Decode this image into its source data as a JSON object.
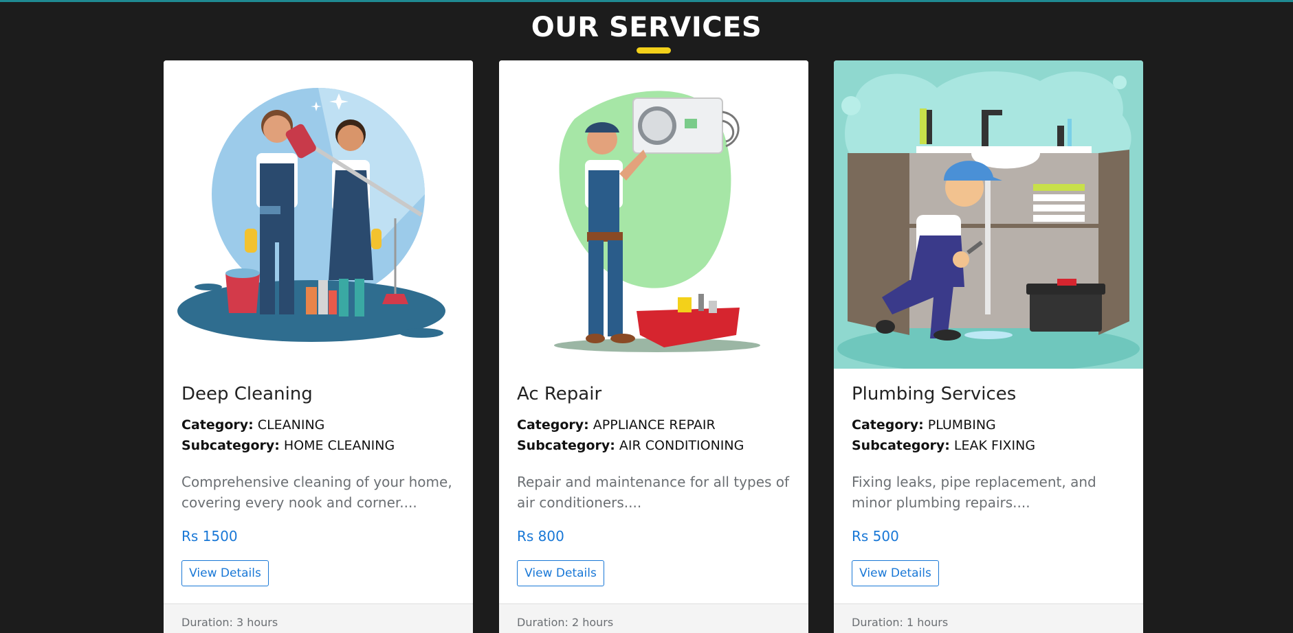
{
  "section": {
    "title": "OUR SERVICES"
  },
  "labels": {
    "category": "Category:",
    "subcategory": "Subcategory:"
  },
  "services": [
    {
      "title": "Deep Cleaning",
      "category": "CLEANING",
      "subcategory": "HOME CLEANING",
      "description": "Comprehensive cleaning of your home, covering every nook and corner....",
      "price": "Rs 1500",
      "button": "View Details",
      "duration": "Duration: 3 hours",
      "image": "cleaning-illustration"
    },
    {
      "title": "Ac Repair",
      "category": "APPLIANCE REPAIR",
      "subcategory": "AIR CONDITIONING",
      "description": "Repair and maintenance for all types of air conditioners....",
      "price": "Rs 800",
      "button": "View Details",
      "duration": "Duration: 2 hours",
      "image": "ac-repair-illustration"
    },
    {
      "title": "Plumbing Services",
      "category": "PLUMBING",
      "subcategory": "LEAK FIXING",
      "description": "Fixing leaks, pipe replacement, and minor plumbing repairs....",
      "price": "Rs 500",
      "button": "View Details",
      "duration": "Duration: 1 hours",
      "image": "plumbing-illustration"
    }
  ],
  "colors": {
    "background": "#1c1c1c",
    "accent_underline": "#f3d11a",
    "link_blue": "#1877d6",
    "top_border": "#1f8a92"
  }
}
